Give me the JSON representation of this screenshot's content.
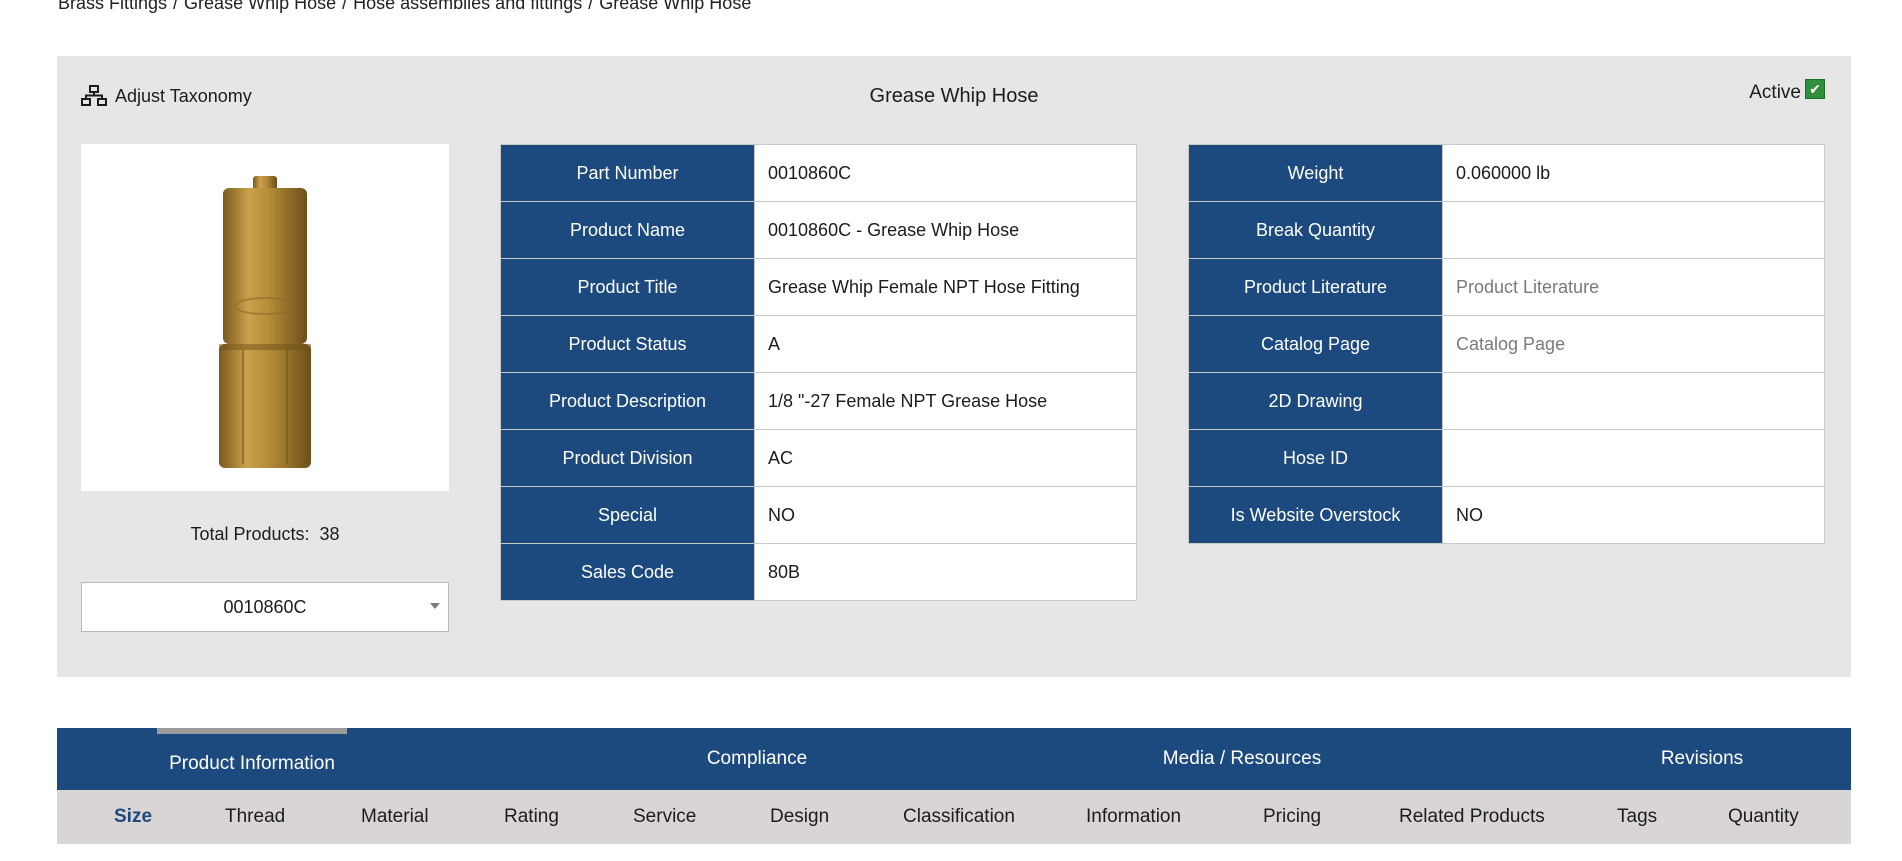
{
  "breadcrumb": [
    "Brass Fittings",
    "Grease Whip Hose",
    "Hose assemblies and fittings",
    "Grease Whip Hose"
  ],
  "panel": {
    "adjust_taxonomy_label": "Adjust Taxonomy",
    "adjust_taxonomy_icon": "sitemap-icon",
    "title": "Grease Whip Hose",
    "active_label": "Active",
    "active_checked": true,
    "total_products_label": "Total Products:",
    "total_products_value": "38",
    "selected_part": "0010860C"
  },
  "spec_left": [
    {
      "label": "Part Number",
      "value": "0010860C"
    },
    {
      "label": "Product Name",
      "value": "0010860C - Grease Whip Hose"
    },
    {
      "label": "Product Title",
      "value": "Grease Whip Female NPT Hose Fitting"
    },
    {
      "label": "Product Status",
      "value": "A"
    },
    {
      "label": "Product Description",
      "value": "1/8 \"-27 Female NPT Grease Hose"
    },
    {
      "label": "Product Division",
      "value": "AC"
    },
    {
      "label": "Special",
      "value": "NO"
    },
    {
      "label": "Sales Code",
      "value": "80B"
    }
  ],
  "spec_right": [
    {
      "label": "Weight",
      "value": "0.060000 lb"
    },
    {
      "label": "Break Quantity",
      "value": ""
    },
    {
      "label": "Product Literature",
      "value": "Product Literature"
    },
    {
      "label": "Catalog Page",
      "value": "Catalog Page"
    },
    {
      "label": "2D Drawing",
      "value": ""
    },
    {
      "label": "Hose ID",
      "value": ""
    },
    {
      "label": "Is Website Overstock",
      "value": "NO"
    }
  ],
  "tabs": [
    "Product Information",
    "Compliance",
    "Media / Resources",
    "Revisions"
  ],
  "subtabs": [
    "Size",
    "Thread",
    "Material",
    "Rating",
    "Service",
    "Design",
    "Classification",
    "Information",
    "Pricing",
    "Related Products",
    "Tags",
    "Quantity"
  ],
  "colors": {
    "primary": "#1d4a7e",
    "panel_bg": "#e6e6e6",
    "subtab_bg": "#d9d5d4",
    "active_check": "#2f8f3a",
    "fitting_brass": "#b8903a"
  }
}
